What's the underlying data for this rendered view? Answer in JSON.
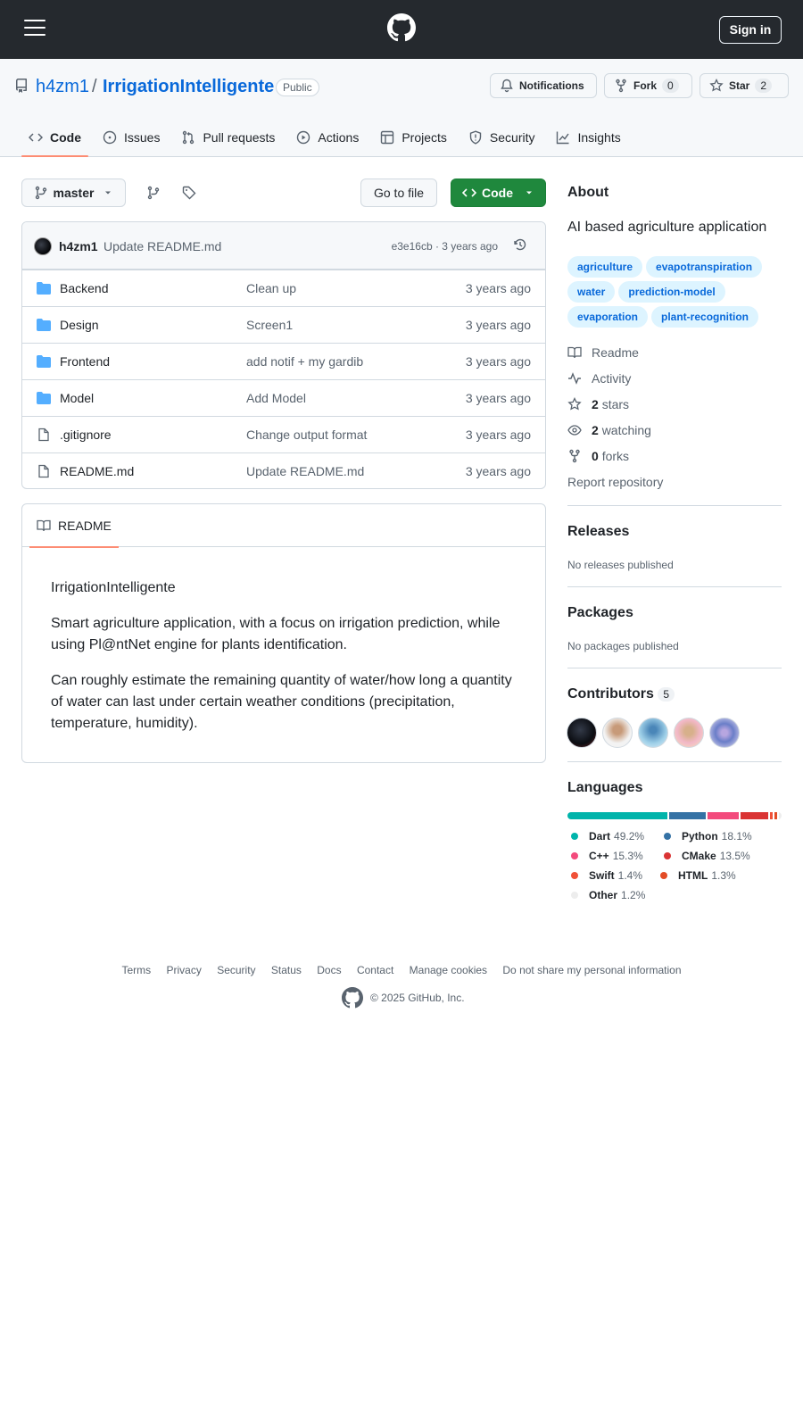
{
  "header": {
    "signin_label": "Sign in"
  },
  "repo": {
    "owner": "h4zm1",
    "slash": "/",
    "name": "IrrigationIntelligente",
    "visibility": "Public"
  },
  "actions": {
    "notifications_label": "Notifications",
    "fork_label": "Fork",
    "fork_count": "0",
    "star_label": "Star",
    "star_count": "2"
  },
  "tabs": [
    {
      "label": "Code",
      "icon": "code-icon"
    },
    {
      "label": "Issues",
      "icon": "issue-icon"
    },
    {
      "label": "Pull requests",
      "icon": "pull-request-icon"
    },
    {
      "label": "Actions",
      "icon": "play-icon"
    },
    {
      "label": "Projects",
      "icon": "table-icon"
    },
    {
      "label": "Security",
      "icon": "shield-icon"
    },
    {
      "label": "Insights",
      "icon": "graph-icon"
    }
  ],
  "toolbar": {
    "branch": "master",
    "goto_label": "Go to file",
    "code_label": "Code"
  },
  "commit": {
    "author": "h4zm1",
    "message": "Update README.md",
    "meta": "e3e16cb · 3 years ago"
  },
  "files": [
    {
      "type": "folder",
      "name": "Backend",
      "commit": "Clean up",
      "date": "3 years ago"
    },
    {
      "type": "folder",
      "name": "Design",
      "commit": "Screen1",
      "date": "3 years ago"
    },
    {
      "type": "folder",
      "name": "Frontend",
      "commit": "add notif + my gardib",
      "date": "3 years ago"
    },
    {
      "type": "folder",
      "name": "Model",
      "commit": "Add Model",
      "date": "3 years ago"
    },
    {
      "type": "file",
      "name": ".gitignore",
      "commit": "Change output format",
      "date": "3 years ago"
    },
    {
      "type": "file",
      "name": "README.md",
      "commit": "Update README.md",
      "date": "3 years ago"
    }
  ],
  "readme": {
    "tab_label": "README",
    "title": "IrrigationIntelligente",
    "p1": "Smart agriculture application, with a focus on irrigation prediction, while using Pl@ntNet engine for plants identification.",
    "p2": "Can roughly estimate the remaining quantity of water/how long a quantity of water can last under certain weather conditions (precipitation, temperature, humidity)."
  },
  "about": {
    "title": "About",
    "description": "AI based agriculture application",
    "topics": [
      "agriculture",
      "evapotranspiration",
      "water",
      "prediction-model",
      "evaporation",
      "plant-recognition"
    ],
    "readme_label": "Readme",
    "activity_label": "Activity",
    "stars_count": "2",
    "stars_label": "stars",
    "watching_count": "2",
    "watching_label": "watching",
    "forks_count": "0",
    "forks_label": "forks",
    "report_label": "Report repository"
  },
  "releases": {
    "title": "Releases",
    "empty": "No releases published"
  },
  "packages": {
    "title": "Packages",
    "empty": "No packages published"
  },
  "contributors": {
    "title": "Contributors",
    "count": "5"
  },
  "languages": {
    "title": "Languages",
    "items": [
      {
        "name": "Dart",
        "pct": "49.2%",
        "color": "#00B4AB"
      },
      {
        "name": "Python",
        "pct": "18.1%",
        "color": "#3572A5"
      },
      {
        "name": "C++",
        "pct": "15.3%",
        "color": "#f34b7d"
      },
      {
        "name": "CMake",
        "pct": "13.5%",
        "color": "#DA3434"
      },
      {
        "name": "Swift",
        "pct": "1.4%",
        "color": "#F05138"
      },
      {
        "name": "HTML",
        "pct": "1.3%",
        "color": "#e34c26"
      },
      {
        "name": "Other",
        "pct": "1.2%",
        "color": "#ededed"
      }
    ]
  },
  "footer": {
    "links": [
      "Terms",
      "Privacy",
      "Security",
      "Status",
      "Docs",
      "Contact",
      "Manage cookies",
      "Do not share my personal information"
    ],
    "copyright": "© 2025 GitHub, Inc."
  }
}
